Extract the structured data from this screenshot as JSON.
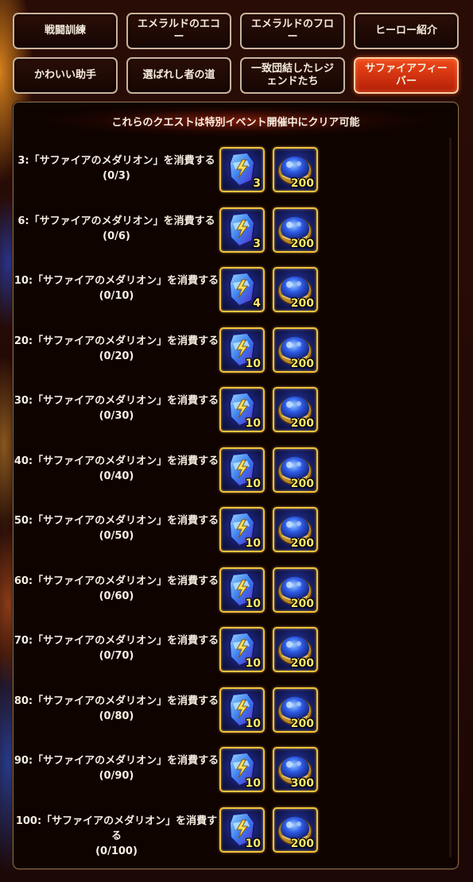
{
  "tabs": [
    {
      "label": "戦闘訓練",
      "active": false
    },
    {
      "label": "エメラルドのエコー",
      "active": false
    },
    {
      "label": "エメラルドのフロー",
      "active": false
    },
    {
      "label": "ヒーロー紹介",
      "active": false
    },
    {
      "label": "かわいい助手",
      "active": false
    },
    {
      "label": "選ばれし者の道",
      "active": false
    },
    {
      "label": "一致団結したレジェンドたち",
      "active": false
    },
    {
      "label": "サファイアフィーバー",
      "active": true
    }
  ],
  "notice": "これらのクエストは特別イベント開催中にクリア可能",
  "icons": {
    "reward1": "sapphire-medallion-icon",
    "reward2": "blue-gem-orb-icon"
  },
  "colors": {
    "active_tab": "#e8401a",
    "frame_gold": "#f2c23c",
    "count_yellow": "#ffe86b"
  },
  "quests": [
    {
      "title": "3:「サファイアのメダリオン」を消費する",
      "progress": "(0/3)",
      "reward1": "3",
      "reward2": "200"
    },
    {
      "title": "6:「サファイアのメダリオン」を消費する",
      "progress": "(0/6)",
      "reward1": "3",
      "reward2": "200"
    },
    {
      "title": "10:「サファイアのメダリオン」を消費する",
      "progress": "(0/10)",
      "reward1": "4",
      "reward2": "200"
    },
    {
      "title": "20:「サファイアのメダリオン」を消費する",
      "progress": "(0/20)",
      "reward1": "10",
      "reward2": "200"
    },
    {
      "title": "30:「サファイアのメダリオン」を消費する",
      "progress": "(0/30)",
      "reward1": "10",
      "reward2": "200"
    },
    {
      "title": "40:「サファイアのメダリオン」を消費する",
      "progress": "(0/40)",
      "reward1": "10",
      "reward2": "200"
    },
    {
      "title": "50:「サファイアのメダリオン」を消費する",
      "progress": "(0/50)",
      "reward1": "10",
      "reward2": "200"
    },
    {
      "title": "60:「サファイアのメダリオン」を消費する",
      "progress": "(0/60)",
      "reward1": "10",
      "reward2": "200"
    },
    {
      "title": "70:「サファイアのメダリオン」を消費する",
      "progress": "(0/70)",
      "reward1": "10",
      "reward2": "200"
    },
    {
      "title": "80:「サファイアのメダリオン」を消費する",
      "progress": "(0/80)",
      "reward1": "10",
      "reward2": "200"
    },
    {
      "title": "90:「サファイアのメダリオン」を消費する",
      "progress": "(0/90)",
      "reward1": "10",
      "reward2": "300"
    },
    {
      "title": "100:「サファイアのメダリオン」を消費する",
      "progress": "(0/100)",
      "reward1": "10",
      "reward2": "200"
    }
  ]
}
